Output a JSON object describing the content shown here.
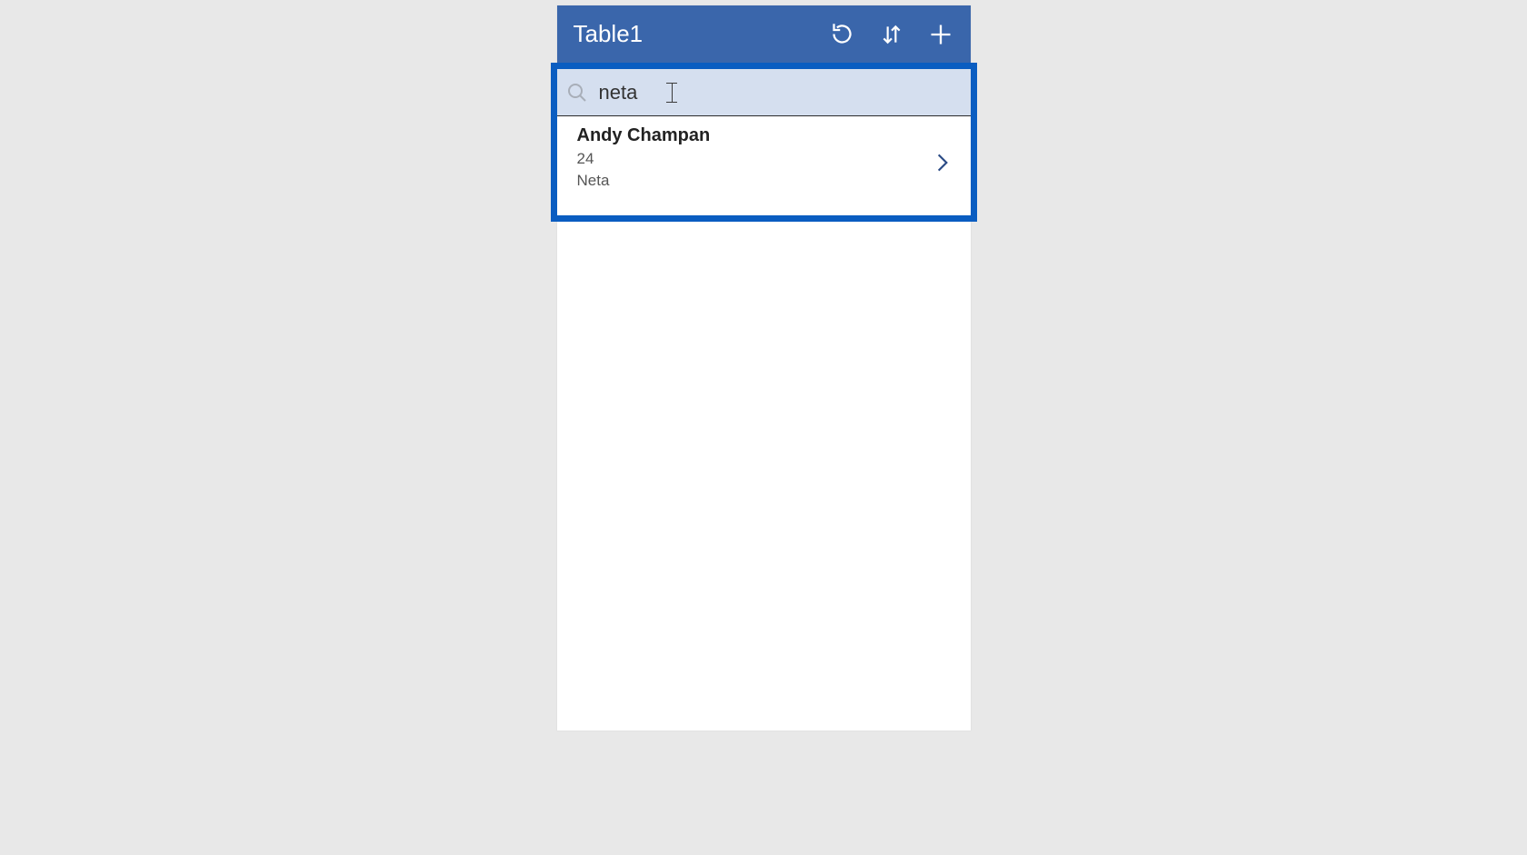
{
  "header": {
    "title": "Table1"
  },
  "search": {
    "value": "neta"
  },
  "results": [
    {
      "title": "Andy Champan",
      "line2": "24",
      "line3": "Neta"
    }
  ]
}
